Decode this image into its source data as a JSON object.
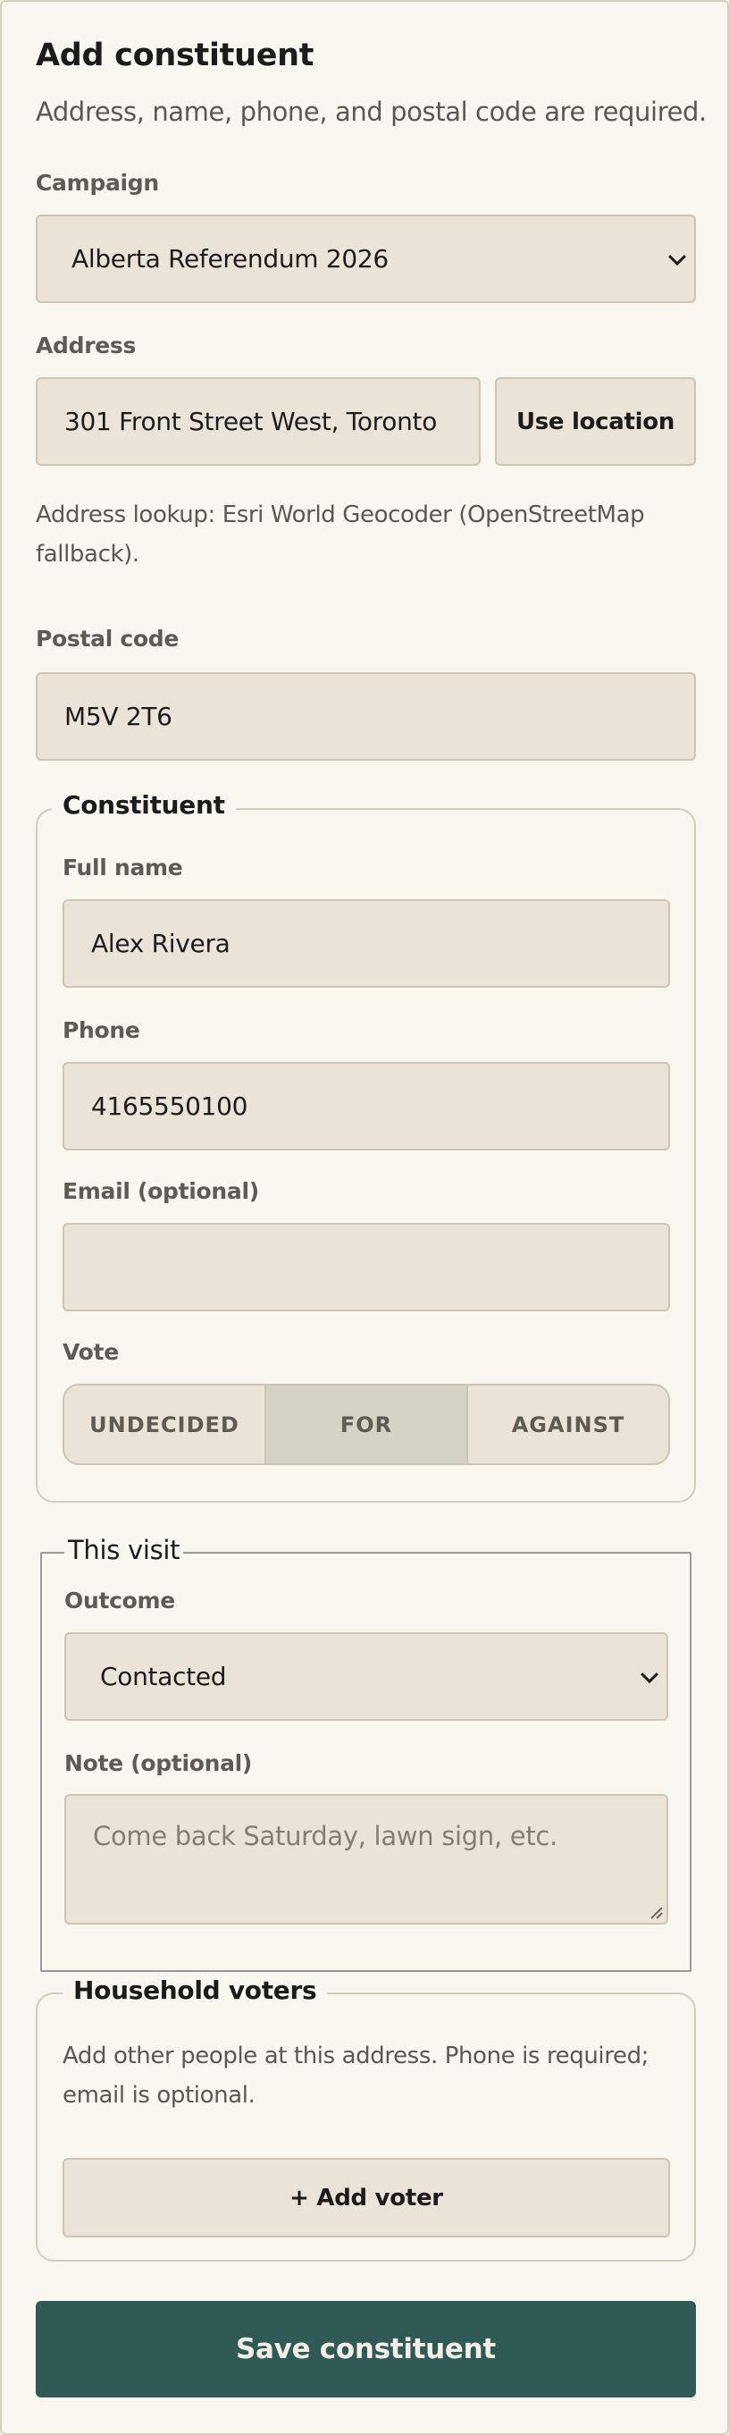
{
  "form": {
    "title": "Add constituent",
    "subtitle": "Address, name, phone, and postal code are required."
  },
  "campaign": {
    "label": "Campaign",
    "selected": "Alberta Referendum 2026"
  },
  "address": {
    "label": "Address",
    "value": "301 Front Street West, Toronto",
    "use_location_label": "Use location",
    "lookup_hint": "Address lookup: Esri World Geocoder (OpenStreetMap fallback)."
  },
  "postal": {
    "label": "Postal code",
    "value": "M5V 2T6"
  },
  "constituent": {
    "legend": "Constituent",
    "full_name_label": "Full name",
    "full_name_value": "Alex Rivera",
    "phone_label": "Phone",
    "phone_value": "4165550100",
    "email_label": "Email (optional)",
    "email_value": "",
    "vote_label": "Vote",
    "vote_options": [
      "UNDECIDED",
      "FOR",
      "AGAINST"
    ],
    "vote_selected": "FOR"
  },
  "visit": {
    "legend": "This visit",
    "outcome_label": "Outcome",
    "outcome_selected": "Contacted",
    "note_label": "Note (optional)",
    "note_placeholder": "Come back Saturday, lawn sign, etc."
  },
  "household": {
    "legend": "Household voters",
    "hint": "Add other people at this address. Phone is required; email is optional.",
    "add_voter_label": "+ Add voter"
  },
  "save_label": "Save constituent",
  "colors": {
    "primary": "#2f5a56",
    "field_bg": "#ebe3d7",
    "page_bg": "#faf7f1",
    "vote_active_bg": "#d4d3c5"
  },
  "icons": {
    "select_arrow": "chevron-down-icon",
    "textarea_resize": "resize-grip-icon"
  }
}
